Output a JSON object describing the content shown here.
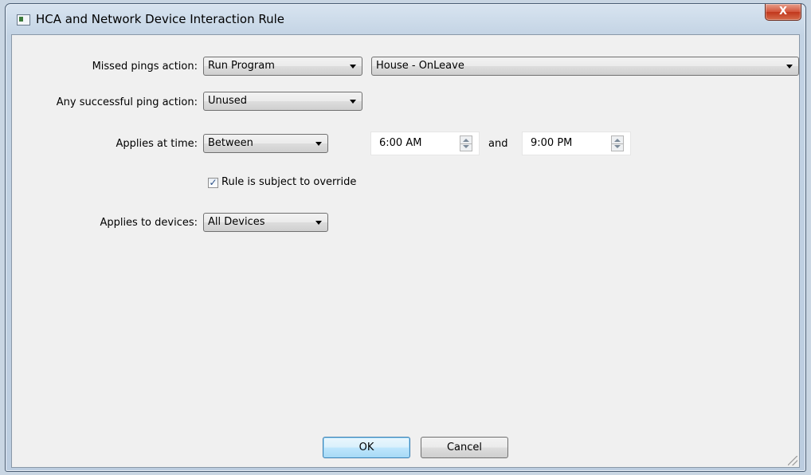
{
  "window": {
    "title": "HCA and Network Device Interaction Rule",
    "close_glyph": "X"
  },
  "form": {
    "missed_pings": {
      "label": "Missed pings action:",
      "action_value": "Run Program",
      "target_value": "House - OnLeave"
    },
    "successful_ping": {
      "label": "Any successful ping action:",
      "action_value": "Unused"
    },
    "applies_time": {
      "label": "Applies at time:",
      "mode_value": "Between",
      "start_time": "6:00 AM",
      "connector": "and",
      "end_time": "9:00 PM"
    },
    "override": {
      "label": "Rule is subject to override",
      "checked": true
    },
    "applies_devices": {
      "label": "Applies to devices:",
      "value": "All Devices"
    }
  },
  "buttons": {
    "ok": "OK",
    "cancel": "Cancel"
  },
  "colors": {
    "accent": "#3c7fb1",
    "close": "#c1371c"
  }
}
